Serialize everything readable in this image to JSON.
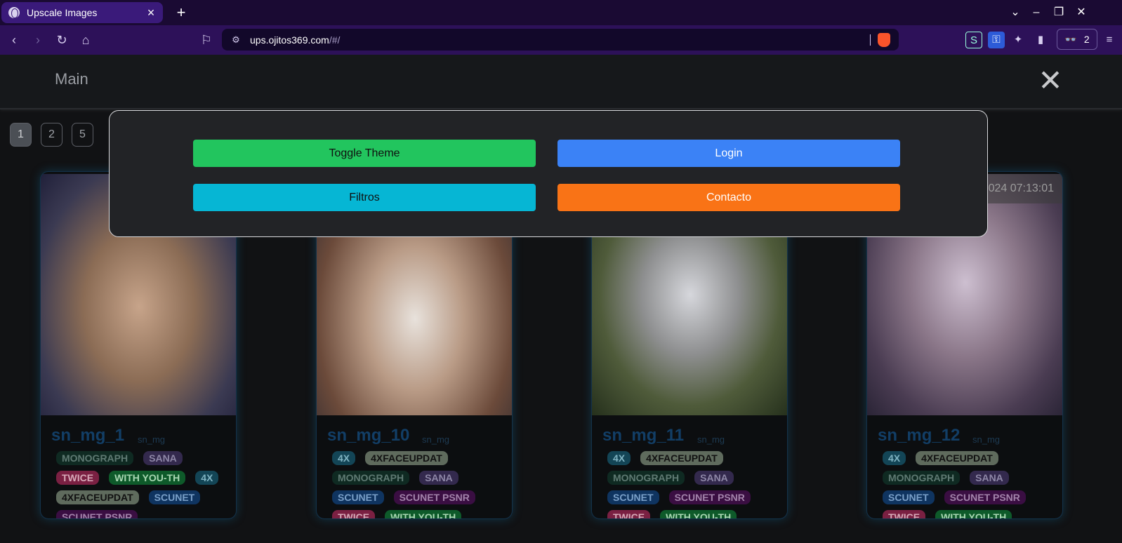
{
  "browser": {
    "tab_title": "Upscale Images",
    "url_host": "ups.ojitos369.com",
    "url_path": "/#/",
    "vpn_count": "2"
  },
  "header": {
    "brand": "Main",
    "close_glyph": "✕"
  },
  "pagination": [
    "1",
    "2",
    "5"
  ],
  "modal": {
    "toggle_theme": "Toggle Theme",
    "login": "Login",
    "filters": "Filtros",
    "contact": "Contacto"
  },
  "cards": [
    {
      "title": "sn_mg_1",
      "subtitle": "sn_mg",
      "timestamp": "",
      "tags": [
        "MONOGRAPH",
        "SANA",
        "TWICE",
        "WITH YOU-TH",
        "4X",
        "4XFACEUPDAT",
        "SCUNET",
        "SCUNET PSNR"
      ]
    },
    {
      "title": "sn_mg_10",
      "subtitle": "sn_mg",
      "timestamp": "",
      "tags": [
        "4X",
        "4XFACEUPDAT",
        "MONOGRAPH",
        "SANA",
        "SCUNET",
        "SCUNET PSNR",
        "TWICE",
        "WITH YOU-TH"
      ]
    },
    {
      "title": "sn_mg_11",
      "subtitle": "sn_mg",
      "timestamp": "",
      "tags": [
        "4X",
        "4XFACEUPDAT",
        "MONOGRAPH",
        "SANA",
        "SCUNET",
        "SCUNET PSNR",
        "TWICE",
        "WITH YOU-TH"
      ]
    },
    {
      "title": "sn_mg_12",
      "subtitle": "sn_mg",
      "timestamp": "024 07:13:01",
      "tags": [
        "4X",
        "4XFACEUPDAT",
        "MONOGRAPH",
        "SANA",
        "SCUNET",
        "SCUNET PSNR",
        "TWICE",
        "WITH YOU-TH"
      ]
    }
  ],
  "colors": {
    "toggle_theme": "#22c55e",
    "login": "#3b82f6",
    "filters": "#06b6d4",
    "contact": "#f97316"
  }
}
